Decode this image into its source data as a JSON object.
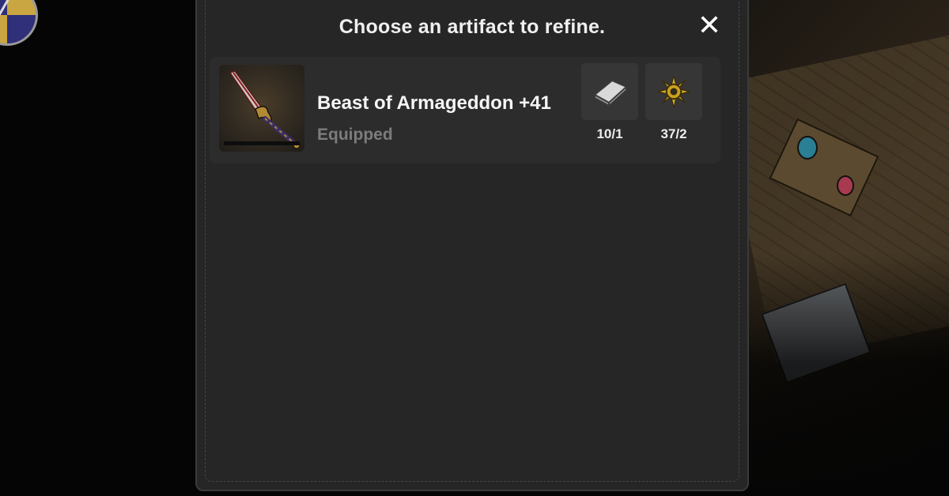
{
  "dialog": {
    "title": "Choose an artifact to refine.",
    "close_icon": "close-icon",
    "close_glyph": "✕"
  },
  "artifacts": [
    {
      "name": "Beast of Armageddon +41",
      "status": "Equipped",
      "icon": "dagger-icon",
      "materials": [
        {
          "icon": "silver-ingot-icon",
          "count": "10/1"
        },
        {
          "icon": "golden-gear-icon",
          "count": "37/2"
        }
      ]
    }
  ],
  "colors": {
    "panel_bg": "#262626",
    "row_bg": "#2c2c2c",
    "slot_bg": "#363636",
    "status_text": "#7c7c7c"
  }
}
